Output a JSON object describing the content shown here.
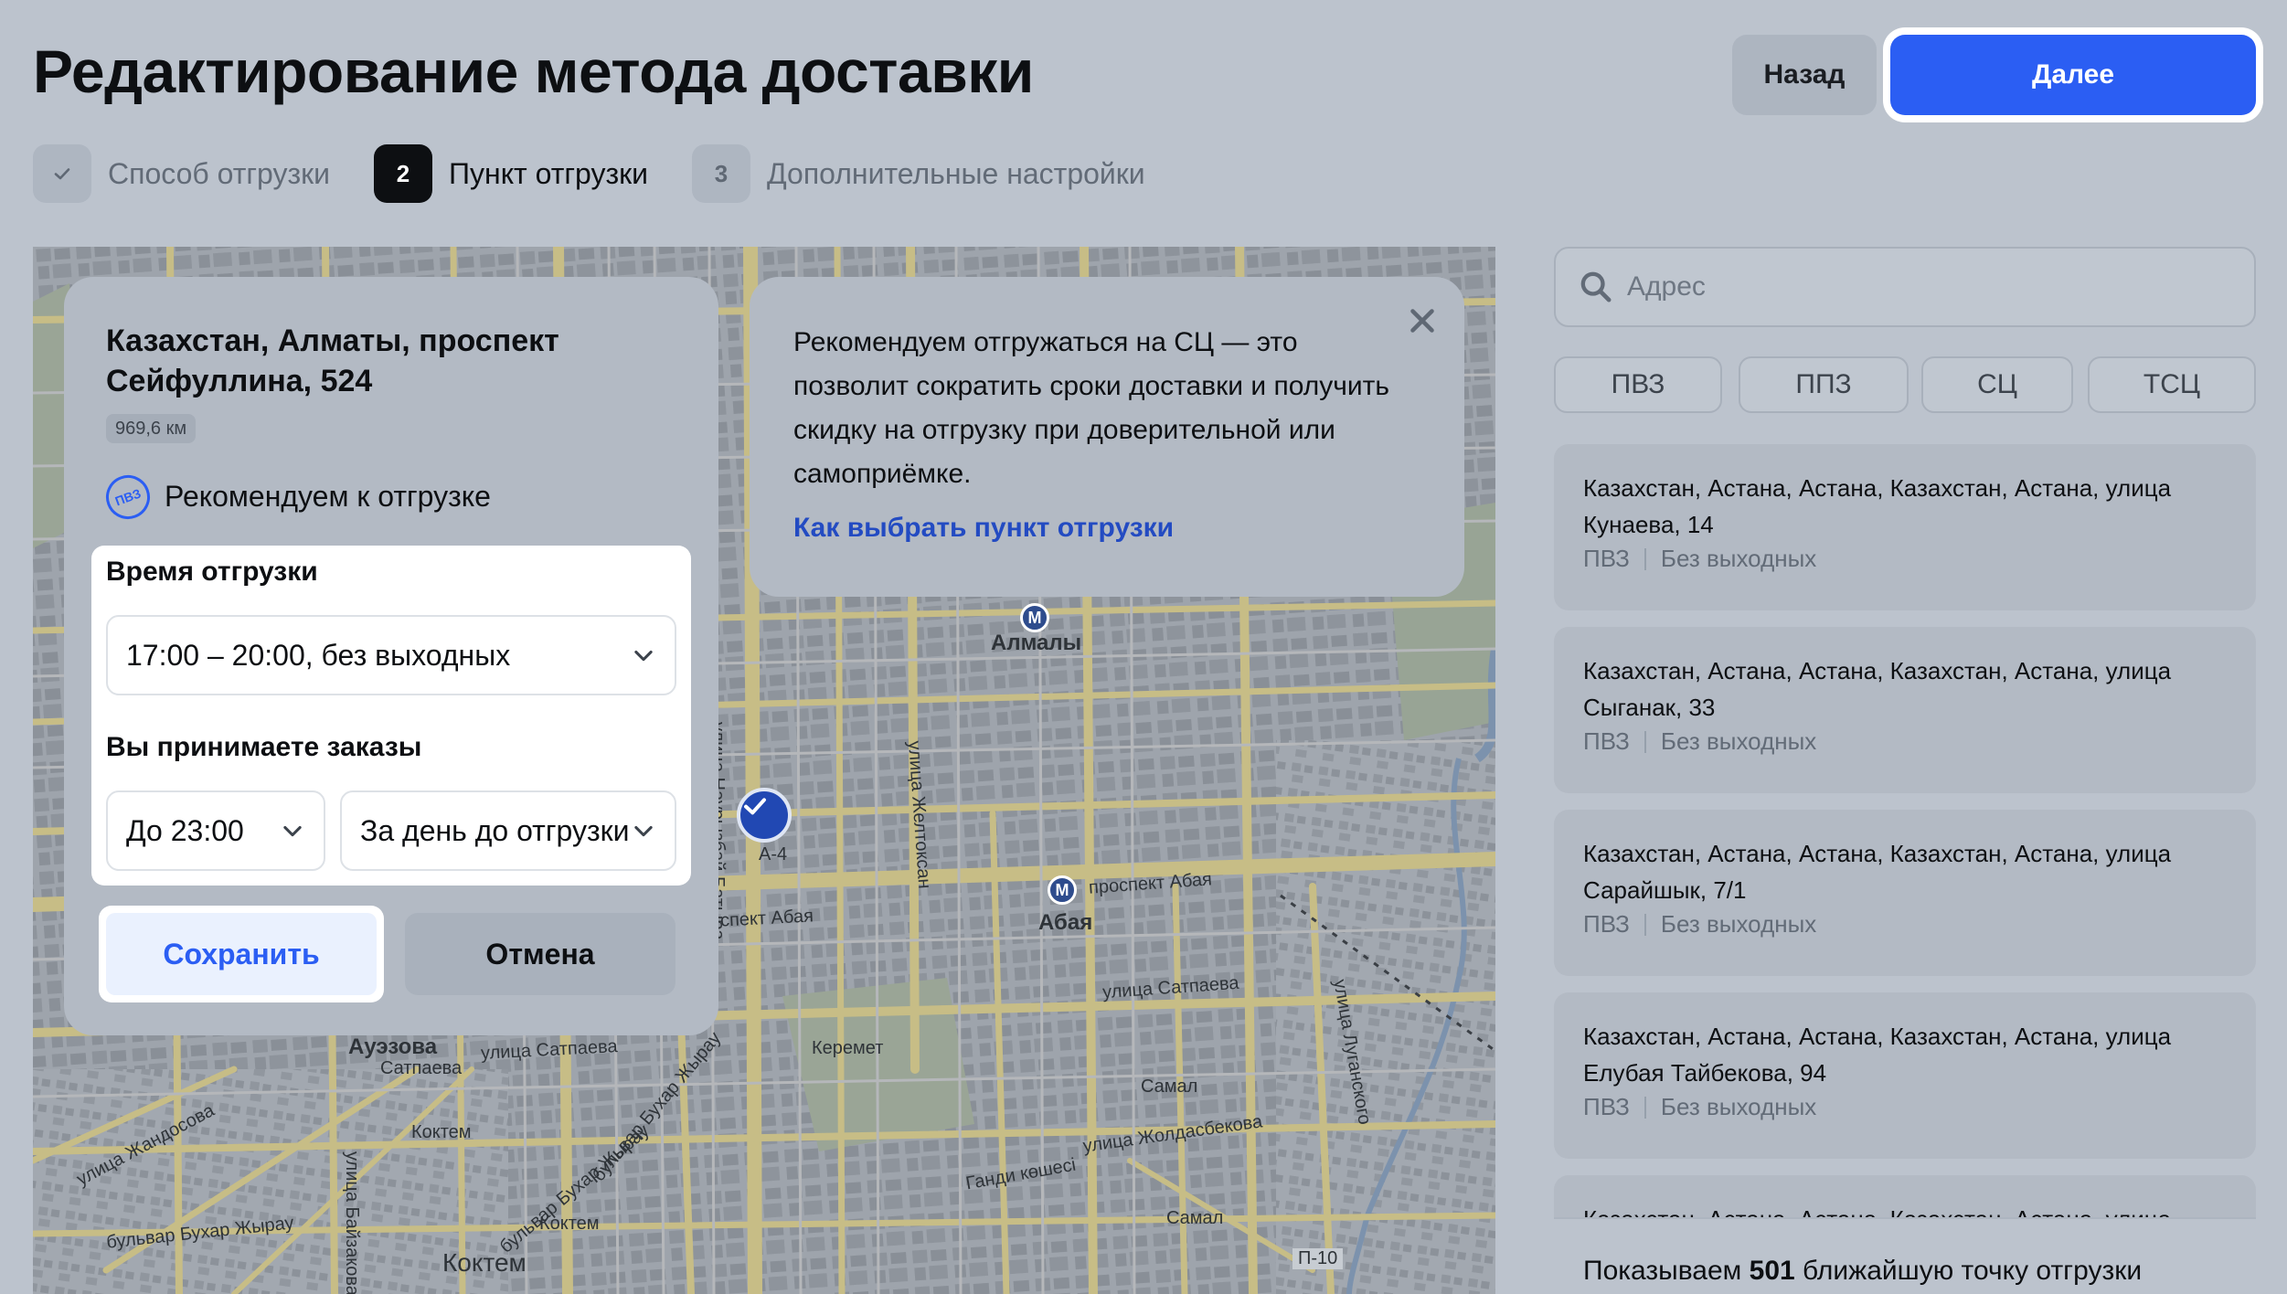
{
  "header": {
    "title": "Редактирование метода доставки",
    "back_label": "Назад",
    "next_label": "Далее"
  },
  "stepper": {
    "steps": [
      {
        "badge": "✓",
        "label": "Способ отгрузки",
        "state": "done"
      },
      {
        "badge": "2",
        "label": "Пункт отгрузки",
        "state": "active"
      },
      {
        "badge": "3",
        "label": "Дополнительные настройки",
        "state": "todo"
      }
    ]
  },
  "point_card": {
    "address": "Казахстан, Алматы, проспект Сейфуллина, 524",
    "distance": "969,6 км",
    "type_icon_text": "ПВЗ",
    "recommend_text": "Рекомендуем к отгрузке",
    "shipping_time": {
      "label": "Время отгрузки",
      "value": "17:00 – 20:00, без выходных"
    },
    "orders": {
      "label": "Вы принимаете заказы",
      "time_value": "До 23:00",
      "day_value": "За день до отгрузки"
    },
    "save_label": "Сохранить",
    "cancel_label": "Отмена"
  },
  "recommendation": {
    "text": "Рекомендуем отгружаться на СЦ — это позволит сократить сроки доставки и получить скидку на отгрузку при доверительной или самоприёмке.",
    "link": "Как выбрать пункт отгрузки"
  },
  "map": {
    "labels": {
      "almaly": "Алмалы",
      "abaya": "Абая",
      "prospekt_abaya": "проспект Абая",
      "prospekt_abaya_left": "спект Абая",
      "nauryzbai": "улица Наурызбай Батыра",
      "zheltoksan": "улица Желтоксан",
      "satpaeva": "улица Сатпаева",
      "satpaeva2": "улица Сатпаева",
      "auezova": "Ауэзова",
      "satpaeva_small": "Сатпаева",
      "keremet": "Керемет",
      "samal": "Самал",
      "samal2": "Самал",
      "koktem": "Коктем",
      "koktem_big": "Коктем",
      "koktem2": "Коктем",
      "zholdasbekova": "улица Жолдасбекова",
      "gandi": "Ганди көшесі",
      "zhandosova": "улица Жандосова",
      "bukhar": "бульвар Бухар Жырау",
      "bukhar2": "бульвар Бухар Жырау",
      "bukhar3": "бульвар Бухар Жырау",
      "luganskogo": "улица Луганского",
      "bayzakova": "улица Байзакова",
      "a4": "А-4",
      "p10": "П-10",
      "metro_letter": "М"
    }
  },
  "sidebar": {
    "search_placeholder": "Адрес",
    "filters": [
      "ПВЗ",
      "ППЗ",
      "СЦ",
      "ТСЦ"
    ],
    "results": [
      {
        "address": "Казахстан, Астана, Астана, Казахстан, Астана, улица Кунаева, 14",
        "type": "ПВЗ",
        "schedule": "Без выходных"
      },
      {
        "address": "Казахстан, Астана, Астана, Казахстан, Астана, улица Сыганак, 33",
        "type": "ПВЗ",
        "schedule": "Без выходных"
      },
      {
        "address": "Казахстан, Астана, Астана, Казахстан, Астана, улица Сарайшык, 7/1",
        "type": "ПВЗ",
        "schedule": "Без выходных"
      },
      {
        "address": "Казахстан, Астана, Астана, Казахстан, Астана, улица Елубая Тайбекова, 94",
        "type": "ПВЗ",
        "schedule": "Без выходных"
      },
      {
        "address": "Казахстан, Астана, Астана, Казахстан, Астана, улица",
        "type": "",
        "schedule": ""
      }
    ],
    "footer_prefix": "Показываем",
    "footer_count": "501",
    "footer_suffix": "ближайшую точку отгрузки"
  },
  "colors": {
    "accent": "#2b5ef3",
    "map_road": "#c9c08a",
    "overlay": "#bcc3cd"
  }
}
